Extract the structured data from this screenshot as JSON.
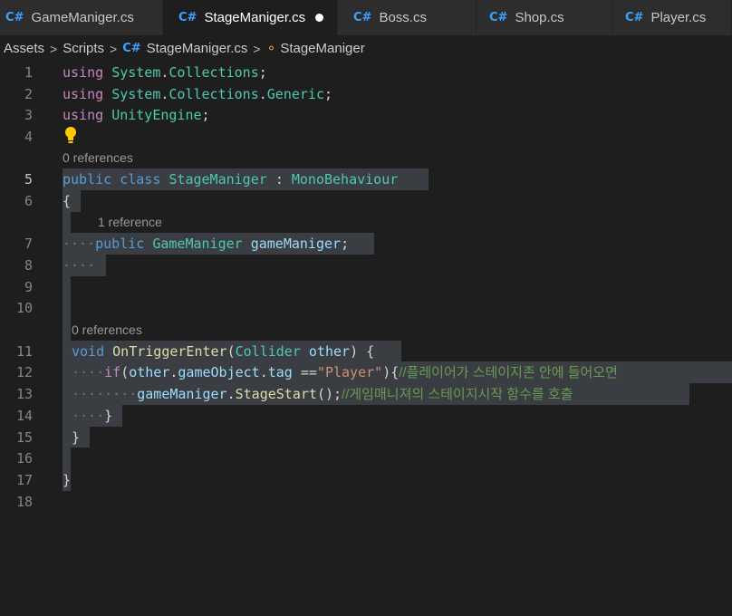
{
  "tabs": [
    {
      "label": "GameManiger.cs",
      "active": false,
      "dirty": false
    },
    {
      "label": "StageManiger.cs",
      "active": true,
      "dirty": true
    },
    {
      "label": "Boss.cs",
      "active": false,
      "dirty": false
    },
    {
      "label": "Shop.cs",
      "active": false,
      "dirty": false
    },
    {
      "label": "Player.cs",
      "active": false,
      "dirty": false
    }
  ],
  "breadcrumb": {
    "items": [
      "Assets",
      "Scripts",
      "StageManiger.cs",
      "StageManiger"
    ],
    "separator": ">"
  },
  "icons": {
    "tab_file": "csharp-icon",
    "breadcrumb_file": "csharp-icon",
    "breadcrumb_symbol": "class-icon",
    "line4": "lightbulb-icon"
  },
  "line_numbers": [
    "1",
    "2",
    "3",
    "4",
    "5",
    "6",
    "7",
    "8",
    "9",
    "10",
    "11",
    "12",
    "13",
    "14",
    "15",
    "16",
    "17",
    "18"
  ],
  "codelens": {
    "class_refs": "0 references",
    "field_refs": "1 reference",
    "method_refs": "0 references"
  },
  "code": {
    "l1": {
      "kw": "using",
      "ns1": "System",
      "dot": ".",
      "ns2": "Collections",
      "end": ";"
    },
    "l2": {
      "kw": "using",
      "ns1": "System",
      "dot1": ".",
      "ns2": "Collections",
      "dot2": ".",
      "ns3": "Generic",
      "end": ";"
    },
    "l3": {
      "kw": "using",
      "ns1": "UnityEngine",
      "end": ";"
    },
    "l5": {
      "kw1": "public",
      "kw2": "class",
      "name": "StageManiger",
      "colon": ":",
      "base": "MonoBehaviour"
    },
    "l6": {
      "brace": "{"
    },
    "l7": {
      "indent": "····",
      "kw": "public",
      "type": "GameManiger",
      "name": "gameManiger",
      "end": ";"
    },
    "l8": {
      "indent": "····"
    },
    "l11": {
      "kw": "void",
      "fn": "OnTriggerEnter",
      "p1": "(",
      "type": "Collider",
      "arg": "other",
      "p2": ")",
      "brace": "{"
    },
    "l12": {
      "indent": "····",
      "kw": "if",
      "p1": "(",
      "var1": "other",
      "d1": ".",
      "var2": "gameObject",
      "d2": ".",
      "var3": "tag",
      "op": "==",
      "str": "\"Player\"",
      "p2": "){",
      "comment": "//플레이어가 스테이지존 안에 들어오면"
    },
    "l13": {
      "indent": "········",
      "var": "gameManiger",
      "dot": ".",
      "fn": "StageStart",
      "call": "();",
      "comment": "//게임매니져의 스테이지시작 함수를 호출"
    },
    "l14": {
      "indent": "····",
      "brace": "}"
    },
    "l15": {
      "brace": "}"
    },
    "l17": {
      "brace": "}"
    }
  },
  "colors": {
    "background": "#1e1e1e",
    "tab_active": "#1e1e1e",
    "tab_inactive": "#2d2d2d",
    "selection": "#3a3d41",
    "keyword": "#c586c0",
    "keyword_blue": "#569cd6",
    "type": "#4ec9b0",
    "function": "#dcdcaa",
    "variable": "#9cdcfe",
    "string": "#ce9178",
    "comment": "#6a9955"
  }
}
